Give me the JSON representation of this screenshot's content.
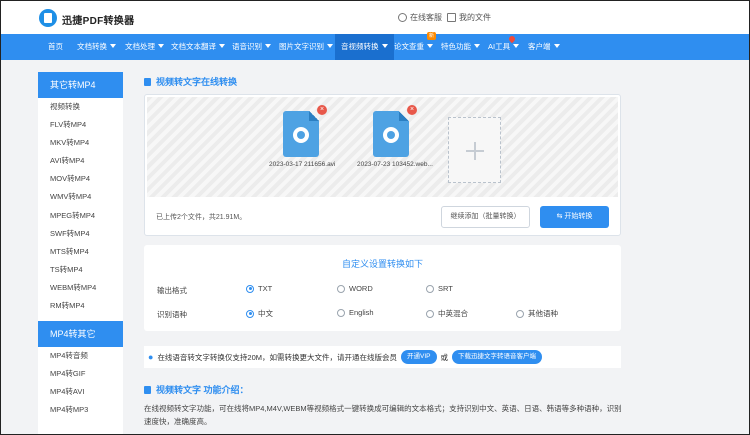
{
  "header": {
    "logo_text": "迅捷PDF转换器",
    "online_service": "在线客服",
    "my_files": "我的文件"
  },
  "nav": {
    "items": [
      {
        "label": "首页"
      },
      {
        "label": "文档转换"
      },
      {
        "label": "文档处理"
      },
      {
        "label": "文档文本翻译"
      },
      {
        "label": "语音识别"
      },
      {
        "label": "图片文字识别"
      },
      {
        "label": "音视频转换"
      },
      {
        "label": "论文查重"
      },
      {
        "label": "特色功能"
      },
      {
        "label": "AI工具"
      },
      {
        "label": "客户端"
      }
    ],
    "new_badge": "新"
  },
  "sidebar": {
    "group1_title": "其它转MP4",
    "group1_items": [
      "视频转换",
      "FLV转MP4",
      "MKV转MP4",
      "AVI转MP4",
      "MOV转MP4",
      "WMV转MP4",
      "MPEG转MP4",
      "SWF转MP4",
      "MTS转MP4",
      "TS转MP4",
      "WEBM转MP4",
      "RM转MP4"
    ],
    "group2_title": "MP4转其它",
    "group2_items": [
      "MP4转音频",
      "MP4转GIF",
      "MP4转AVI",
      "MP4转MP3"
    ]
  },
  "main": {
    "section_title": "视频转文字在线转换",
    "files": [
      {
        "name": "2023-03-17 211656.avi"
      },
      {
        "name": "2023-07-23 103452.web..."
      }
    ],
    "upload_status": "已上传2个文件，共21.91M。",
    "continue_button": "继续添加（批量转换）",
    "start_button": "开始转换",
    "settings_title": "自定义设置转换如下",
    "output_format_label": "输出格式",
    "output_formats": [
      "TXT",
      "WORD",
      "SRT"
    ],
    "output_selected": "TXT",
    "language_label": "识别语种",
    "languages": [
      "中文",
      "English",
      "中英混合",
      "其他语种"
    ],
    "language_selected": "中文",
    "notice_text": "在线语音转文字转换仅支持20M，如需转换更大文件，请开通在线版会员",
    "notice_or": "或",
    "vip_button": "开通VIP",
    "download_button": "下载迅捷文字转语音客户端",
    "intro_title": "视频转文字 功能介绍：",
    "intro_text": "在线视频转文字功能，可在线将MP4,M4V,WEBM等视频格式一键转换成可编辑的文本格式；支持识别中文、英语、日语、韩语等多种语种，识别速度快，准确度高。"
  }
}
